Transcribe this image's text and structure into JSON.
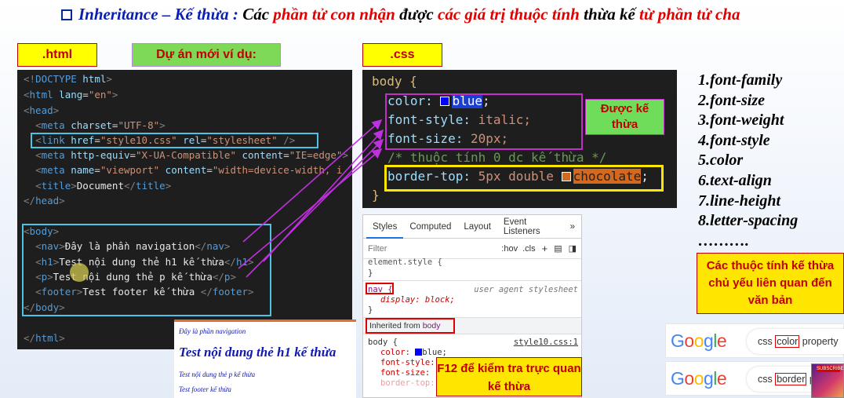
{
  "title": {
    "part1": "Inheritance – Kế thừa : ",
    "part2": "Các ",
    "part3": "phần tử con nhận",
    "part4": " được ",
    "part5": "các giá trị thuộc tính",
    "part6": " thừa kế ",
    "part7": "từ phần tử cha"
  },
  "labels": {
    "html": ".html",
    "project": "Dự án mới ví dụ:",
    "css": ".css",
    "inherited_note": "Được kế thừa",
    "f12_note": "F12 để kiểm tra trực quan kế thừa",
    "text_note": "Các thuộc tính kế thừa chủ yếu liên quan đến văn bản"
  },
  "html_code": [
    "<!DOCTYPE html>",
    "<html lang=\"en\">",
    "<head>",
    "  <meta charset=\"UTF-8\">",
    "  <link href=\"style10.css\" rel=\"stylesheet\" />",
    "  <meta http-equiv=\"X-UA-Compatible\" content=\"IE=edge\">",
    "  <meta name=\"viewport\" content=\"width=device-width, i",
    "  <title>Document</title>",
    "</head>",
    "",
    "<body>",
    "  <nav>Đây là phần navigation</nav>",
    "  <h1>Test nội dung thẻ h1 kế thừa</h1>",
    "  <p>Test nội dung thẻ p kế thừa</p>",
    "  <footer>Test footer kế thừa </footer>",
    "</body>",
    "",
    "</html>"
  ],
  "css_code": {
    "selector": "body {",
    "color_prop": "color: ",
    "color_val": "blue",
    "style_prop": "font-style: ",
    "style_val": "italic;",
    "size_prop": "font-size: ",
    "size_val": "20px;",
    "comment": "/* thuộc tính 0 dc kế thừa */",
    "border_prop": "border-top: ",
    "border_val": "5px double ",
    "border_color": "chocolate",
    "close": "}"
  },
  "devtools": {
    "tabs": [
      "Styles",
      "Computed",
      "Layout",
      "Event Listeners",
      "»"
    ],
    "active_tab": "Styles",
    "filter_placeholder": "Filter",
    "hov": ":hov",
    "cls": ".cls",
    "element_style": "element.style {",
    "close_brace": "}",
    "nav_selector": "nav {",
    "user_agent": "user agent stylesheet",
    "display_line": "display: block;",
    "inherited_from": "Inherited from ",
    "inherited_el": "body",
    "body_selector": "body {",
    "source": "style10.css:1",
    "color_line": "color: ",
    "color_value": "blue;",
    "font_style_line": "font-style:",
    "font_size_line": "font-size:",
    "border_top_line": "border-top:"
  },
  "preview": {
    "nav": "Đây là phần navigation",
    "h1": "Test nội dung thẻ h1 kế thừa",
    "p": "Test nội dung thẻ p kế thừa",
    "footer": "Test footer kế thừa"
  },
  "inherited_list": [
    "1.font-family",
    "2.font-size",
    "3.font-weight",
    "4.font-style",
    "5.color",
    "6.text-align",
    "7.line-height",
    "8.letter-spacing",
    "………."
  ],
  "google": [
    {
      "logo": "Google",
      "query_before": "css ",
      "query_highlight": "color",
      "query_after": " property"
    },
    {
      "logo": "Google",
      "query_before": "css ",
      "query_highlight": "border",
      "query_after": " property"
    }
  ],
  "avatar_badge": "SUBSCRIBE",
  "colors": {
    "swatch_blue": "#0000ff",
    "swatch_chocolate": "#d2691e",
    "arrow": "#c030e0"
  }
}
